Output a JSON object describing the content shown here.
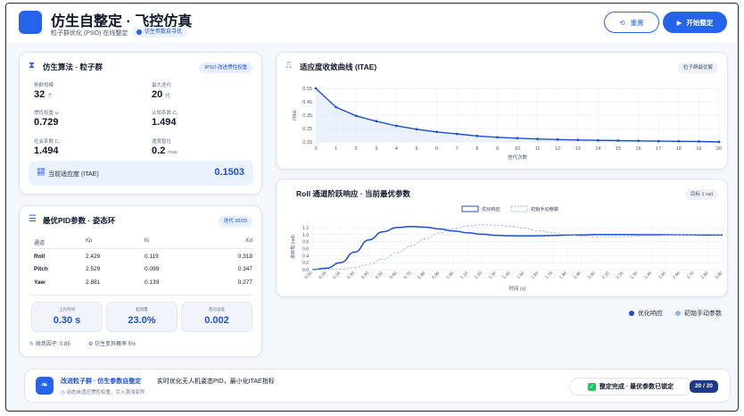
{
  "header": {
    "title": "仿生自整定 · 飞控仿真",
    "subtitle": "粒子群优化 (PSO) 在线整定",
    "badge": "仿生参数自寻优",
    "reset_label": "重置",
    "start_label": "开始整定"
  },
  "algo": {
    "title": "仿生算法 · 粒子群",
    "badge": "IPSO 改进惯性权重",
    "metrics": [
      {
        "label": "种群规模",
        "value": "32",
        "unit": "个"
      },
      {
        "label": "最大迭代",
        "value": "20",
        "unit": "代"
      },
      {
        "label": "惯性权重 ω",
        "value": "0.729",
        "unit": ""
      },
      {
        "label": "认知系数 C₁",
        "value": "1.494",
        "unit": ""
      },
      {
        "label": "社会系数 C₂",
        "value": "1.494",
        "unit": ""
      },
      {
        "label": "速度智位",
        "value": "0.2",
        "unit": "max"
      }
    ],
    "fitness_label": "当前适应度 (ITAE)",
    "fitness_value": "0.1503"
  },
  "pid": {
    "title": "最优PID参数 · 姿态环",
    "badge": "迭代 20/20",
    "headers": [
      "通道",
      "Kp",
      "Ki",
      "Kd"
    ],
    "rows": [
      {
        "name": "Roll",
        "kp": "2.429",
        "ki": "0.119",
        "kd": "0.318"
      },
      {
        "name": "Pitch",
        "kp": "2.529",
        "ki": "0.099",
        "kd": "0.347"
      },
      {
        "name": "Yaw",
        "kp": "2.881",
        "ki": "0.139",
        "kd": "0.277"
      }
    ],
    "stats": [
      {
        "label": "上升时间",
        "value": "0.30 s"
      },
      {
        "label": "超调量",
        "value": "23.0%"
      },
      {
        "label": "稳态误差",
        "value": "0.002"
      }
    ],
    "convergence": "收敛因子: 0.85",
    "mutation": "仿生变异概率 5%"
  },
  "convergence_chart": {
    "title": "适应度收敛曲线 (ITAE)",
    "badge": "粒子群最优解"
  },
  "response_chart": {
    "title": "Roll 通道阶跃响应 · 当前最优参数",
    "badge": "目标 1 rad",
    "legend_bottom": [
      "优化响应",
      "初始手动参数"
    ]
  },
  "chart_data": [
    {
      "type": "line",
      "title": "适应度收敛曲线 (ITAE)",
      "xlabel": "迭代次数",
      "ylabel": "ITAE",
      "xlim": [
        0,
        20
      ],
      "ylim": [
        0.15,
        0.55
      ],
      "x_ticks": [
        0,
        1,
        2,
        3,
        4,
        5,
        6,
        7,
        8,
        9,
        10,
        11,
        12,
        13,
        14,
        15,
        16,
        17,
        18,
        19,
        20
      ],
      "y_ticks": [
        0.15,
        0.25,
        0.35,
        0.45,
        0.55
      ],
      "grid": true,
      "x": [
        0,
        1,
        2,
        3,
        4,
        5,
        6,
        7,
        8,
        9,
        10,
        11,
        12,
        13,
        14,
        15,
        16,
        17,
        18,
        19,
        20
      ],
      "values": [
        0.55,
        0.41,
        0.345,
        0.305,
        0.27,
        0.245,
        0.225,
        0.21,
        0.195,
        0.185,
        0.178,
        0.172,
        0.168,
        0.165,
        0.162,
        0.16,
        0.158,
        0.156,
        0.155,
        0.153,
        0.1503
      ]
    },
    {
      "type": "line",
      "title": "Roll 通道阶跃响应 · 当前最优参数",
      "xlabel": "时间 (s)",
      "ylabel": "滚转角 (rad)",
      "xlim": [
        0,
        2.9
      ],
      "ylim": [
        0,
        1.3
      ],
      "y_ticks": [
        0.0,
        0.2,
        0.4,
        0.6,
        0.8,
        1.0,
        1.2
      ],
      "x_ticks": [
        "0.00",
        "0.10",
        "0.20",
        "0.30",
        "0.40",
        "0.50",
        "0.60",
        "0.70",
        "0.80",
        "0.90",
        "1.00",
        "1.10",
        "1.20",
        "1.30",
        "1.40",
        "1.50",
        "1.60",
        "1.70",
        "1.80",
        "1.90",
        "2.00",
        "2.10",
        "2.20",
        "2.30",
        "2.40",
        "2.50",
        "2.60",
        "2.70",
        "2.80",
        "2.90"
      ],
      "legend": [
        "优化响应",
        "初始手动参数"
      ],
      "grid": true,
      "series": [
        {
          "name": "优化响应",
          "x": [
            0,
            0.1,
            0.2,
            0.3,
            0.4,
            0.5,
            0.6,
            0.7,
            0.8,
            0.9,
            1.0,
            1.1,
            1.2,
            1.3,
            1.4,
            1.5,
            1.6,
            1.7,
            1.8,
            1.9,
            2.0,
            2.2,
            2.4,
            2.6,
            2.8,
            2.9
          ],
          "values": [
            0,
            0.04,
            0.2,
            0.5,
            0.85,
            1.08,
            1.2,
            1.23,
            1.21,
            1.16,
            1.1,
            1.05,
            1.01,
            0.98,
            0.965,
            0.96,
            0.965,
            0.975,
            0.985,
            0.99,
            1.0,
            1.0,
            0.995,
            0.995,
            0.99,
            0.99
          ]
        },
        {
          "name": "初始手动参数",
          "x": [
            0,
            0.1,
            0.2,
            0.3,
            0.4,
            0.5,
            0.6,
            0.7,
            0.8,
            0.9,
            1.0,
            1.1,
            1.2,
            1.3,
            1.4,
            1.5,
            1.6,
            1.7,
            1.8,
            1.9,
            2.0,
            2.2,
            2.4,
            2.6,
            2.8,
            2.9
          ],
          "values": [
            0,
            0.0,
            0.02,
            0.06,
            0.15,
            0.3,
            0.48,
            0.68,
            0.88,
            1.05,
            1.17,
            1.25,
            1.28,
            1.27,
            1.24,
            1.18,
            1.11,
            1.05,
            1.0,
            0.96,
            0.935,
            0.94,
            0.97,
            0.995,
            1.005,
            1.0
          ]
        }
      ]
    }
  ],
  "legend_colors": {
    "optimized": "#1d4ed8",
    "initial": "#93b4f0"
  },
  "banner": {
    "title": "改进粒子群 · 仿生参数自整定",
    "description": "实时优化无人机姿态PID，最小化ITAE指标",
    "sub": "动态自适应惯性权重，引入混沌变异",
    "status": "整定完成 · 最优参数已锁定",
    "iteration": "20 / 20"
  }
}
